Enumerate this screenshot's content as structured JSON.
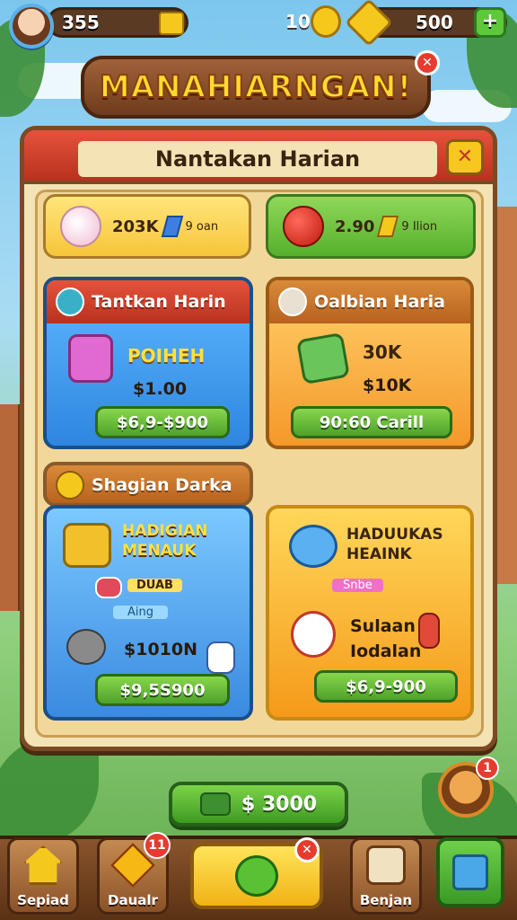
{
  "topbar": {
    "gold": "355",
    "coins": "10",
    "gems": "500",
    "plus": "+"
  },
  "title": "MANAHIARNGAN!",
  "panel": {
    "title": "Nantakan Harian"
  },
  "rewards": [
    {
      "amount": "203K",
      "sub": "9 oan"
    },
    {
      "amount": "2.90",
      "sub": "9 Ilion"
    }
  ],
  "cards": {
    "daily": {
      "header": "Tantkan Harin",
      "item": "POIHEH",
      "price": "$1.00",
      "button": "$6,9-$900"
    },
    "bonus": {
      "header": "Oalbian Haria",
      "item": "30K",
      "price": "$10K",
      "button": "90:60 Carill"
    },
    "special_header": "Shagian Darka",
    "pack1": {
      "title": "HADIGIAN MENAUK",
      "tag1": "DUAB",
      "tag2": "Aing",
      "price": "$1010N",
      "button": "$9,5S900"
    },
    "pack2": {
      "title": "HADUUKAS HEAINK",
      "tag1": "Snbe",
      "line1": "Sulaan",
      "line2": "Iodalan",
      "button": "$6,9-900"
    }
  },
  "claim": {
    "label": "$ 3000"
  },
  "badges": {
    "friend": "1",
    "nav2": "11"
  },
  "nav": [
    {
      "label": "Sepiad"
    },
    {
      "label": "Daualr"
    },
    {
      "label": "Benjan"
    }
  ],
  "colors": {
    "accent": "#f7c61f",
    "header": "#e5523c",
    "green": "#56b02d",
    "blue": "#3aa0e8",
    "orange": "#f59a2a"
  }
}
